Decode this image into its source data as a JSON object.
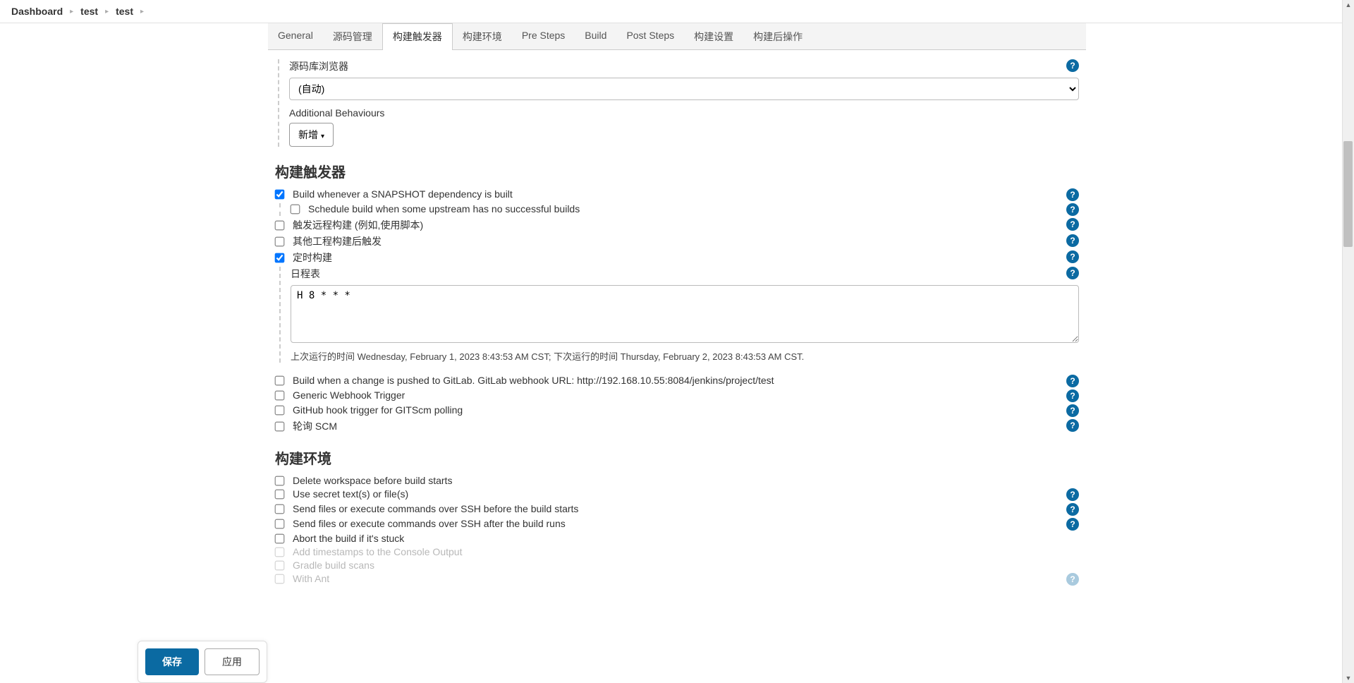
{
  "breadcrumbs": {
    "root": "Dashboard",
    "item1": "test",
    "item2": "test"
  },
  "tabs": {
    "general": "General",
    "scm": "源码管理",
    "triggers": "构建触发器",
    "env": "构建环境",
    "presteps": "Pre Steps",
    "build": "Build",
    "poststeps": "Post Steps",
    "settings": "构建设置",
    "postbuild": "构建后操作"
  },
  "repo_browser": {
    "label": "源码库浏览器",
    "value": "(自动)"
  },
  "additional_behaviours": {
    "label": "Additional Behaviours",
    "add_btn": "新增"
  },
  "triggers_section": {
    "title": "构建触发器",
    "snapshot": "Build whenever a SNAPSHOT dependency is built",
    "schedule_upstream": "Schedule build when some upstream has no successful builds",
    "remote_trigger": "触发远程构建 (例如,使用脚本)",
    "after_other": "其他工程构建后触发",
    "timed": "定时构建",
    "schedule_label": "日程表",
    "schedule_value": "H 8 * * *",
    "schedule_hint": "上次运行的时间 Wednesday, February 1, 2023 8:43:53 AM CST; 下次运行的时间 Thursday, February 2, 2023 8:43:53 AM CST.",
    "gitlab_push": "Build when a change is pushed to GitLab. GitLab webhook URL: http://192.168.10.55:8084/jenkins/project/test",
    "generic_webhook": "Generic Webhook Trigger",
    "github_hook": "GitHub hook trigger for GITScm polling",
    "poll_scm": "轮询 SCM"
  },
  "env_section": {
    "title": "构建环境",
    "delete_ws": "Delete workspace before build starts",
    "secret": "Use secret text(s) or file(s)",
    "ssh_before": "Send files or execute commands over SSH before the build starts",
    "ssh_after": "Send files or execute commands over SSH after the build runs",
    "abort_stuck": "Abort the build if it's stuck",
    "timestamps": "Add timestamps to the Console Output",
    "gradle_scans": "Gradle build scans",
    "with_ant": "With Ant"
  },
  "buttons": {
    "save": "保存",
    "apply": "应用"
  }
}
